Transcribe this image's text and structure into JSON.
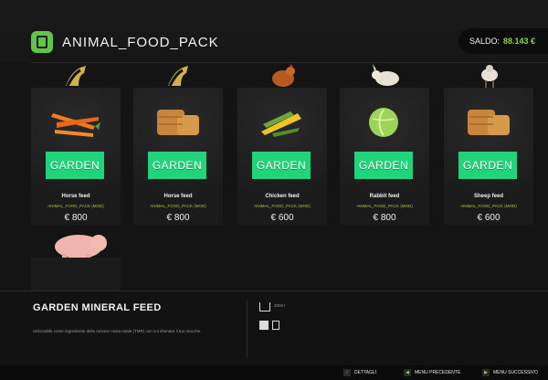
{
  "header": {
    "title": "ANIMAL_FOOD_PACK",
    "saldo_label": "SALDO:",
    "saldo_value": "88.143 €"
  },
  "products": [
    {
      "name": "Horse feed",
      "pack": "ANIMAL_FOOD_PACK (MOD)",
      "price": "€ 800",
      "brand": "GARDEN",
      "top_icon": "horse-icon",
      "image": "carrots"
    },
    {
      "name": "Horse feed",
      "pack": "ANIMAL_FOOD_PACK (MOD)",
      "price": "€ 800",
      "brand": "GARDEN",
      "top_icon": "horse-icon",
      "image": "hay-bale"
    },
    {
      "name": "Chicken feed",
      "pack": "ANIMAL_FOOD_PACK (MOD)",
      "price": "€ 600",
      "brand": "GARDEN",
      "top_icon": "chicken-icon",
      "image": "corn"
    },
    {
      "name": "Rabbit feed",
      "pack": "ANIMAL_FOOD_PACK (MOD)",
      "price": "€ 800",
      "brand": "GARDEN",
      "top_icon": "rabbit-icon",
      "image": "cabbage"
    },
    {
      "name": "Sheep feed",
      "pack": "ANIMAL_FOOD_PACK (MOD)",
      "price": "€ 600",
      "brand": "GARDEN",
      "top_icon": "sheep-icon",
      "image": "hay-bale"
    }
  ],
  "details": {
    "title": "GARDEN MINERAL FEED",
    "description": "Utilizzabile come ingrediente della razione mista totale (TMR) con cui sfamare il tuo mucche.",
    "capacity_label": "2000 l"
  },
  "footer": {
    "details_label": "DETTAGLI",
    "prev_label": "MENU PRECEDENTE",
    "next_label": "MENU SUCCESSIVO",
    "details_key": "✓",
    "prev_key": "◀",
    "next_key": "▶"
  },
  "colors": {
    "accent": "#8bd44a",
    "brand_green": "#1fd47b",
    "pack_text": "#a8c63a"
  }
}
